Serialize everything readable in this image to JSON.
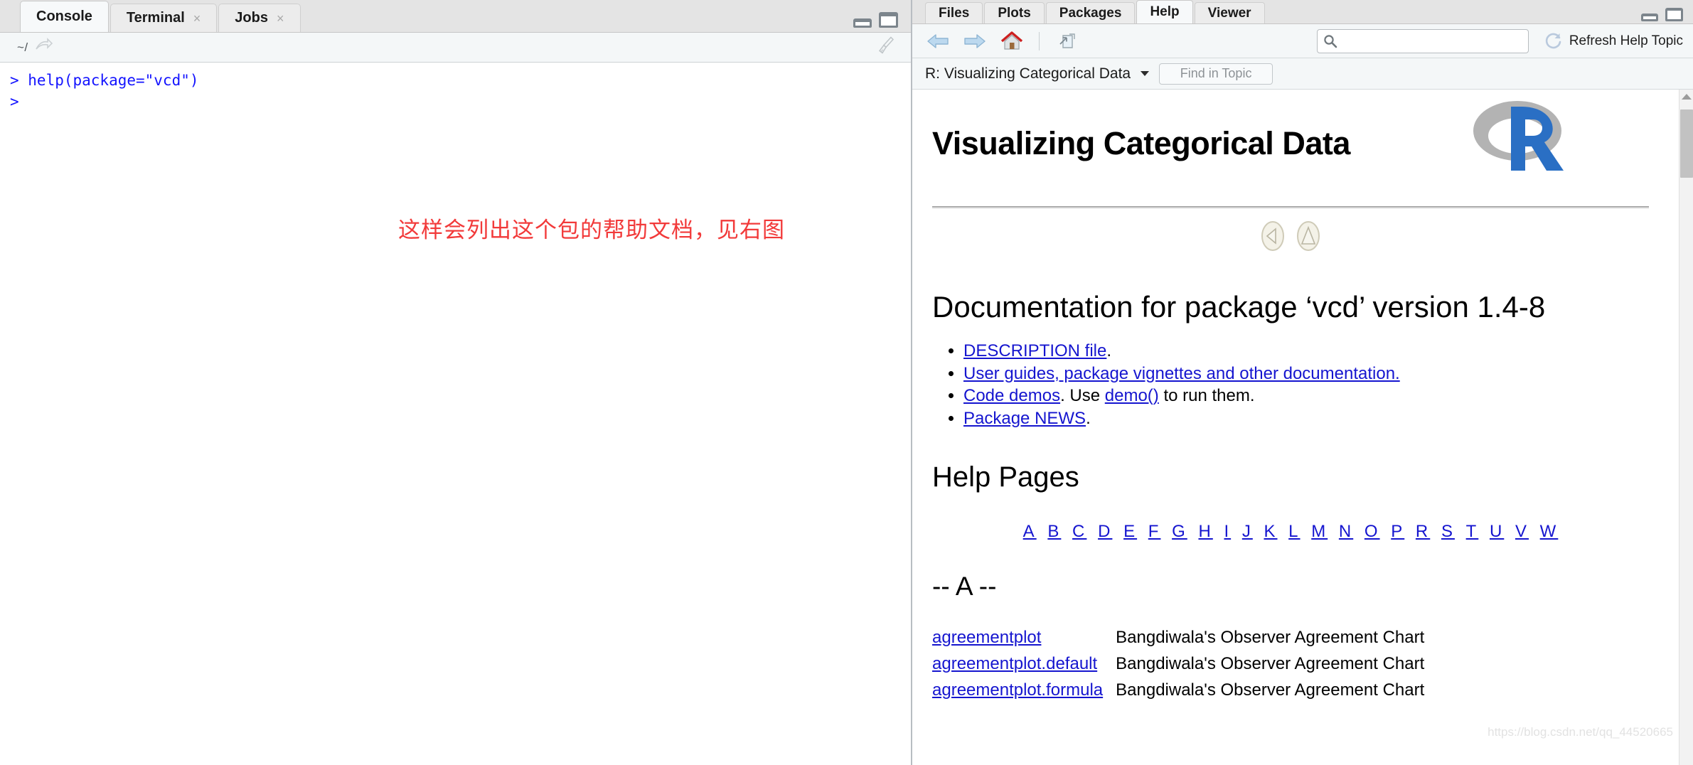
{
  "console": {
    "tabs": [
      {
        "label": "Console",
        "active": true,
        "closable": false
      },
      {
        "label": "Terminal",
        "active": false,
        "closable": true
      },
      {
        "label": "Jobs",
        "active": false,
        "closable": true
      }
    ],
    "close_glyph": "×",
    "path": "~/",
    "lines": [
      "> help(package=\"vcd\")",
      "> "
    ],
    "annotation": "这样会列出这个包的帮助文档，见右图",
    "annotation_color": "#f23a3a",
    "icons": {
      "path_arrow": "open-in-new-window-icon",
      "clear": "broom-icon",
      "minimize": "minimize-icon",
      "maximize": "maximize-icon"
    }
  },
  "help": {
    "tabs": [
      {
        "label": "Files",
        "active": false
      },
      {
        "label": "Plots",
        "active": false
      },
      {
        "label": "Packages",
        "active": false
      },
      {
        "label": "Help",
        "active": true
      },
      {
        "label": "Viewer",
        "active": false
      }
    ],
    "toolbar": {
      "back": "back-arrow-icon",
      "forward": "forward-arrow-icon",
      "home": "home-icon",
      "popout": "show-in-new-window-icon",
      "search_value": "",
      "search_placeholder": "",
      "refresh_label": "Refresh Help Topic"
    },
    "topic_bar": {
      "title": "R: Visualizing Categorical Data",
      "find_placeholder": "Find in Topic"
    },
    "document": {
      "heading": "Visualizing Categorical Data",
      "logo": "r-logo-icon",
      "nav_back": "nav-back-oval-icon",
      "nav_up": "nav-up-oval-icon",
      "subheading": "Documentation for package ‘vcd’ version 1.4-8",
      "bullets": [
        {
          "parts": [
            {
              "text": "DESCRIPTION file",
              "link": true
            },
            {
              "text": ".",
              "link": false
            }
          ]
        },
        {
          "parts": [
            {
              "text": "User guides, package vignettes and other documentation.",
              "link": true
            }
          ]
        },
        {
          "parts": [
            {
              "text": "Code demos",
              "link": true
            },
            {
              "text": ". Use ",
              "link": false
            },
            {
              "text": "demo()",
              "link": true
            },
            {
              "text": " to run them.",
              "link": false
            }
          ]
        },
        {
          "parts": [
            {
              "text": "Package NEWS",
              "link": true
            },
            {
              "text": ".",
              "link": false
            }
          ]
        }
      ],
      "help_pages_heading": "Help Pages",
      "alphabet": [
        "A",
        "B",
        "C",
        "D",
        "E",
        "F",
        "G",
        "H",
        "I",
        "J",
        "K",
        "L",
        "M",
        "N",
        "O",
        "P",
        "R",
        "S",
        "T",
        "U",
        "V",
        "W"
      ],
      "section_letter": "-- A --",
      "entries": [
        {
          "name": "agreementplot",
          "desc": "Bangdiwala's Observer Agreement Chart"
        },
        {
          "name": "agreementplot.default",
          "desc": "Bangdiwala's Observer Agreement Chart"
        },
        {
          "name": "agreementplot.formula",
          "desc": "Bangdiwala's Observer Agreement Chart"
        }
      ]
    },
    "watermark": "https://blog.csdn.net/qq_44520665"
  },
  "colors": {
    "console_text": "#1414ff",
    "link": "#1515cf",
    "annotation": "#f23a3a",
    "r_blue": "#2a6fc4",
    "r_gray": "#b3b3b3"
  }
}
